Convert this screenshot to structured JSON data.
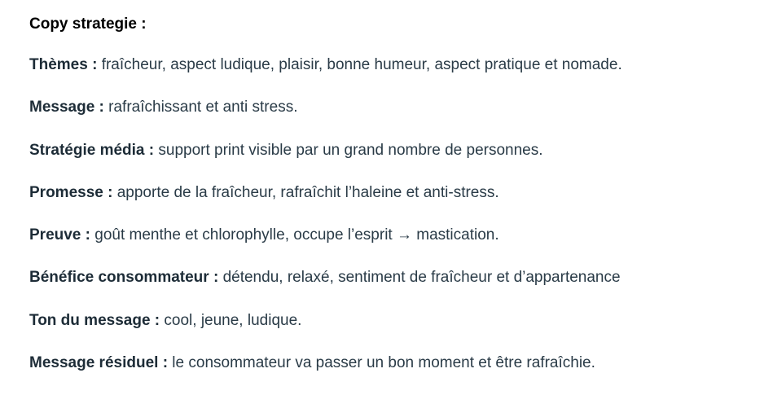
{
  "document": {
    "heading": "Copy strategie :",
    "items": [
      {
        "label": "Thèmes :",
        "text": " fraîcheur, aspect ludique, plaisir, bonne humeur, aspect pratique et nomade."
      },
      {
        "label": "Message :",
        "text": " rafraîchissant et anti stress."
      },
      {
        "label": "Stratégie média :",
        "text": " support print visible par un grand nombre de personnes."
      },
      {
        "label": "Promesse :",
        "text": " apporte de la fraîcheur, rafraîchit l’haleine et anti-stress."
      },
      {
        "label": "Preuve :",
        "text": " goût menthe et chlorophylle, occupe l’esprit → mastication."
      },
      {
        "label": "Bénéfice consommateur :",
        "text": " détendu, relaxé, sentiment de fraîcheur et d’appartenance"
      },
      {
        "label": "Ton du message :",
        "text": " cool, jeune, ludique."
      },
      {
        "label": "Message résiduel :",
        "text": " le consommateur va passer un bon moment et être rafraîchie."
      }
    ]
  }
}
